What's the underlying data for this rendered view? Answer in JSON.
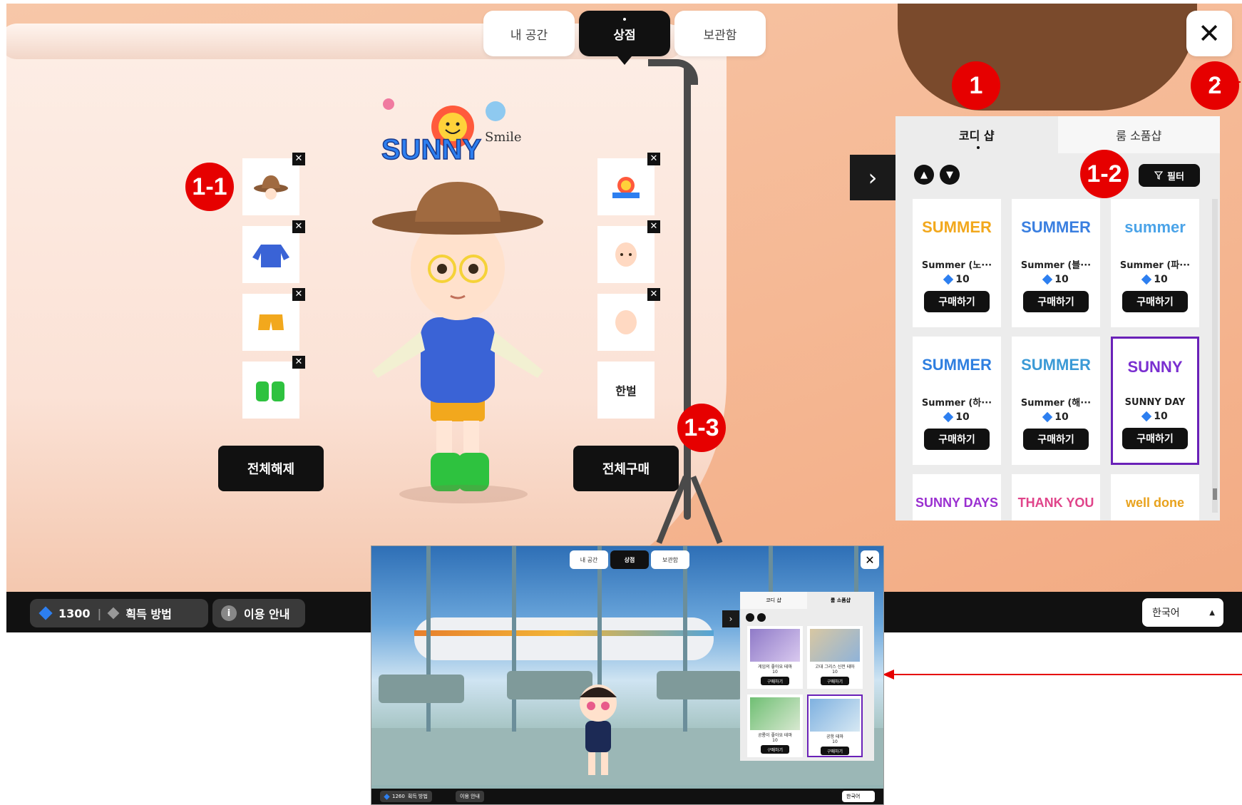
{
  "top_nav": {
    "tabs": [
      "내 공간",
      "상점",
      "보관함"
    ],
    "active": "상점"
  },
  "close_label": "✕",
  "logo_text": "SUNNY",
  "logo_sub": "Smile",
  "badges": {
    "b1": "1",
    "b2": "2",
    "b11": "1-1",
    "b12": "1-2",
    "b13": "1-3"
  },
  "left_slots": [
    {
      "name": "hat"
    },
    {
      "name": "jacket"
    },
    {
      "name": "shorts"
    },
    {
      "name": "sneakers"
    }
  ],
  "right_slots": [
    {
      "name": "sticker"
    },
    {
      "name": "face"
    },
    {
      "name": "hair"
    },
    {
      "label": "한벌"
    }
  ],
  "slot_remove_label": "✕",
  "buttons": {
    "release_all": "전체해제",
    "buy_all": "전체구매"
  },
  "panel": {
    "tabs": [
      "코디 샵",
      "룸 소품샵"
    ],
    "active_tab": "코디 샵",
    "filter_label": "필터",
    "collapse_label": "›",
    "items": [
      {
        "name": "Summer (노···",
        "price": "10",
        "buy": "구매하기",
        "thumb": "SUMMER",
        "color": "#f2a81d"
      },
      {
        "name": "Summer (블···",
        "price": "10",
        "buy": "구매하기",
        "thumb": "SUMMER",
        "color": "#3a7fe0"
      },
      {
        "name": "Summer (파···",
        "price": "10",
        "buy": "구매하기",
        "thumb": "summer",
        "color": "#4aa3e8"
      },
      {
        "name": "Summer (하···",
        "price": "10",
        "buy": "구매하기",
        "thumb": "SUMMER",
        "color": "#2f7fe0"
      },
      {
        "name": "Summer (해···",
        "price": "10",
        "buy": "구매하기",
        "thumb": "SUMMER",
        "color": "#3b9ad6"
      },
      {
        "name": "SUNNY DAY",
        "price": "10",
        "buy": "구매하기",
        "thumb": "SUNNY",
        "color": "#7a2fd0",
        "selected": true
      },
      {
        "thumb": "SUNNY DAYS",
        "color": "#9a2fd0"
      },
      {
        "thumb": "THANK YOU",
        "color": "#e0448a"
      },
      {
        "thumb": "well done",
        "color": "#e8a21d"
      }
    ]
  },
  "bottom_bar": {
    "gems": "1300",
    "how_to_get": "획득 방법",
    "guide": "이용 안내",
    "language": "한국어"
  },
  "inset": {
    "tabs": [
      "내 공간",
      "상점",
      "보관함"
    ],
    "panel_tabs": [
      "코디 샵",
      "룸 소품샵"
    ],
    "items": [
      {
        "name": "게임의 좋아요 테마",
        "price": "10",
        "buy": "구매하기"
      },
      {
        "name": "고대 그리스 신전 테마",
        "price": "10",
        "buy": "구매하기"
      },
      {
        "name": "공룡이 좋아요 테마",
        "price": "10",
        "buy": "구매하기"
      },
      {
        "name": "공항 테마",
        "price": "10",
        "buy": "구매하기",
        "selected": true
      }
    ],
    "gems": "1260",
    "how_to_get": "획득 방법",
    "guide": "이용 안내",
    "language": "한국어"
  },
  "colors": {
    "accent": "#111111",
    "badge": "#e60000",
    "selected": "#6a21b8",
    "gem": "#2d7ff0"
  }
}
